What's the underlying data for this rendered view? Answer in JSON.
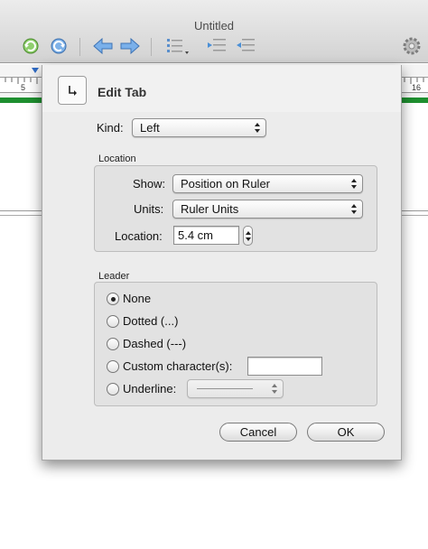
{
  "window": {
    "title": "Untitled"
  },
  "toolbar": {
    "undo_icon": "undo-icon",
    "redo_icon": "redo-icon",
    "back_icon": "arrow-left-icon",
    "forward_icon": "arrow-right-icon",
    "list_icon": "list-style-icon",
    "indent_icons": [
      "indent-increase-icon",
      "indent-decrease-icon"
    ],
    "settings_icon": "gear-icon"
  },
  "ruler": {
    "labels": [
      "5",
      "16"
    ]
  },
  "dialog": {
    "title": "Edit Tab",
    "icon": "tab-stop-icon",
    "kind": {
      "label": "Kind:",
      "value": "Left"
    },
    "location_group": {
      "title": "Location",
      "show": {
        "label": "Show:",
        "value": "Position on Ruler"
      },
      "units": {
        "label": "Units:",
        "value": "Ruler Units"
      },
      "location": {
        "label": "Location:",
        "value": "5.4 cm"
      }
    },
    "leader_group": {
      "title": "Leader",
      "options": [
        {
          "label": "None",
          "selected": true
        },
        {
          "label": "Dotted (...)",
          "selected": false
        },
        {
          "label": "Dashed (---)",
          "selected": false
        },
        {
          "label": "Custom character(s):",
          "selected": false
        },
        {
          "label": "Underline:",
          "selected": false
        }
      ],
      "custom_value": ""
    },
    "buttons": {
      "cancel": "Cancel",
      "ok": "OK"
    }
  },
  "colors": {
    "accent_green": "#1e8f2f",
    "toolbar_blue": "#4a8fd6"
  }
}
